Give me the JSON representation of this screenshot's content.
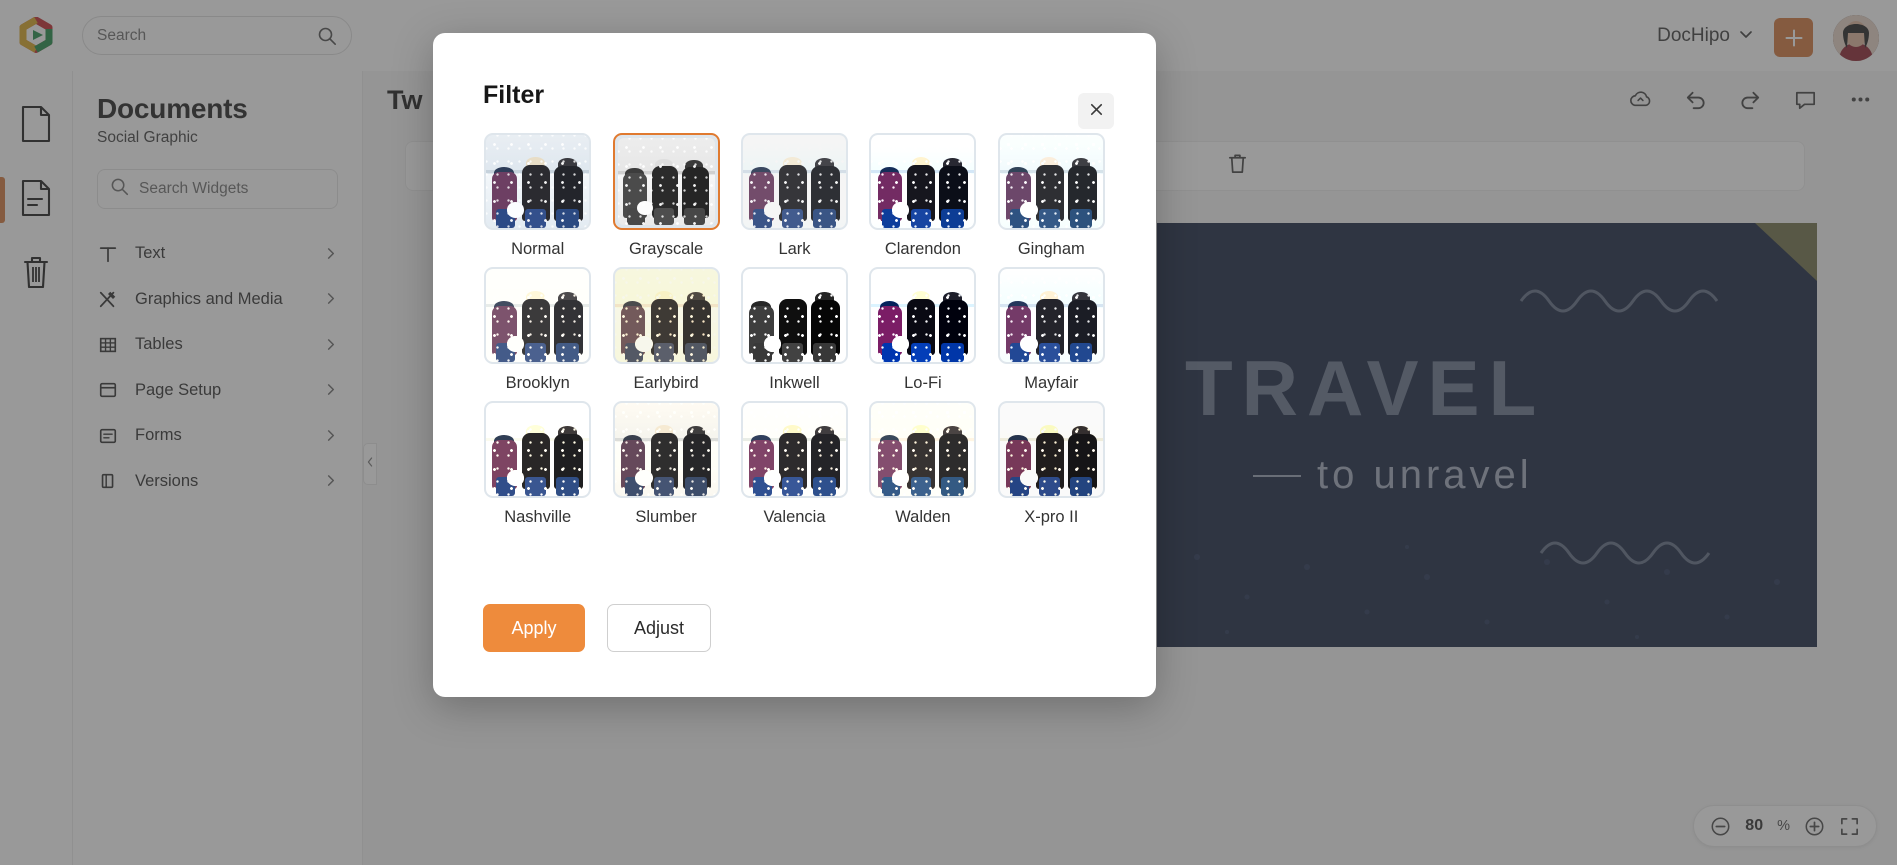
{
  "app": {
    "brand_name": "DocHipo",
    "accent_color": "#ee8b3c",
    "accent_dark": "#d2763a",
    "selected_border_color": "#e07a30"
  },
  "topbar": {
    "logo_icon": "dochipo-hexagon-play-logo",
    "search_placeholder": "Search",
    "search_value": "",
    "search_icon": "search-icon",
    "brand_label": "DocHipo",
    "brand_chevron_icon": "chevron-down-icon",
    "add_button_icon": "plus-icon",
    "avatar_icon": "user-avatar"
  },
  "rail": {
    "items": [
      {
        "name": "pages",
        "icon": "page-icon",
        "active": false
      },
      {
        "name": "document",
        "icon": "document-lines-icon",
        "active": true
      },
      {
        "name": "trash",
        "icon": "trash-icon",
        "active": false
      }
    ]
  },
  "panel": {
    "title": "Documents",
    "subtitle": "Social Graphic",
    "search_placeholder": "Search Widgets",
    "search_value": "",
    "search_icon": "search-icon",
    "nav": [
      {
        "label": "Text",
        "icon": "text-t-icon"
      },
      {
        "label": "Graphics and Media",
        "icon": "graphics-media-icon"
      },
      {
        "label": "Tables",
        "icon": "table-grid-icon"
      },
      {
        "label": "Page Setup",
        "icon": "page-setup-icon"
      },
      {
        "label": "Forms",
        "icon": "forms-icon"
      },
      {
        "label": "Versions",
        "icon": "versions-icon"
      }
    ],
    "collapse_icon": "chevron-left-icon"
  },
  "canvas": {
    "doc_title": "Tw",
    "toolbar_icons": [
      "cloud-save-icon",
      "undo-icon",
      "redo-icon",
      "comment-icon",
      "more-options-icon"
    ],
    "subtoolbar_icons": [
      "delete-icon"
    ],
    "artboard": {
      "headline": "TRAVEL",
      "subline": "to unravel",
      "background_color": "#16233f"
    }
  },
  "zoom_control": {
    "zoom_out_icon": "zoom-out-icon",
    "value": "80",
    "unit": "%",
    "zoom_in_icon": "zoom-in-icon",
    "fit_screen_icon": "fit-to-screen-icon"
  },
  "modal": {
    "title": "Filter",
    "close_icon": "close-icon",
    "selected_filter": "Grayscale",
    "filters": [
      {
        "label": "Normal",
        "css": "none"
      },
      {
        "label": "Grayscale",
        "css": "grayscale(1)"
      },
      {
        "label": "Lark",
        "css": "saturate(0.85) brightness(1.1) contrast(0.92)"
      },
      {
        "label": "Clarendon",
        "css": "contrast(1.25) saturate(1.25)"
      },
      {
        "label": "Gingham",
        "css": "brightness(1.08) hue-rotate(-8deg) saturate(0.82)"
      },
      {
        "label": "Brooklyn",
        "css": "contrast(0.92) brightness(1.12) sepia(0.18)"
      },
      {
        "label": "Earlybird",
        "css": "sepia(0.6) contrast(0.9) saturate(1.1) brightness(1.02)"
      },
      {
        "label": "Inkwell",
        "css": "grayscale(1) contrast(1.35) brightness(1.08)"
      },
      {
        "label": "Lo-Fi",
        "css": "saturate(1.45) contrast(1.4)"
      },
      {
        "label": "Mayfair",
        "css": "contrast(1.1) saturate(1.1) brightness(1.05)"
      },
      {
        "label": "Nashville",
        "css": "sepia(0.28) contrast(1.12) brightness(1.08) saturate(1.3)"
      },
      {
        "label": "Slumber",
        "css": "saturate(0.7) brightness(1.02) sepia(0.18)"
      },
      {
        "label": "Valencia",
        "css": "sepia(0.22) saturate(1.4) contrast(1.05) brightness(1.06)"
      },
      {
        "label": "Walden",
        "css": "sepia(0.35) saturate(1.5) hue-rotate(-10deg) brightness(1.1)"
      },
      {
        "label": "X-pro II",
        "css": "sepia(0.3) contrast(1.2) saturate(1.5) brightness(0.98)"
      }
    ],
    "apply_label": "Apply",
    "adjust_label": "Adjust"
  }
}
